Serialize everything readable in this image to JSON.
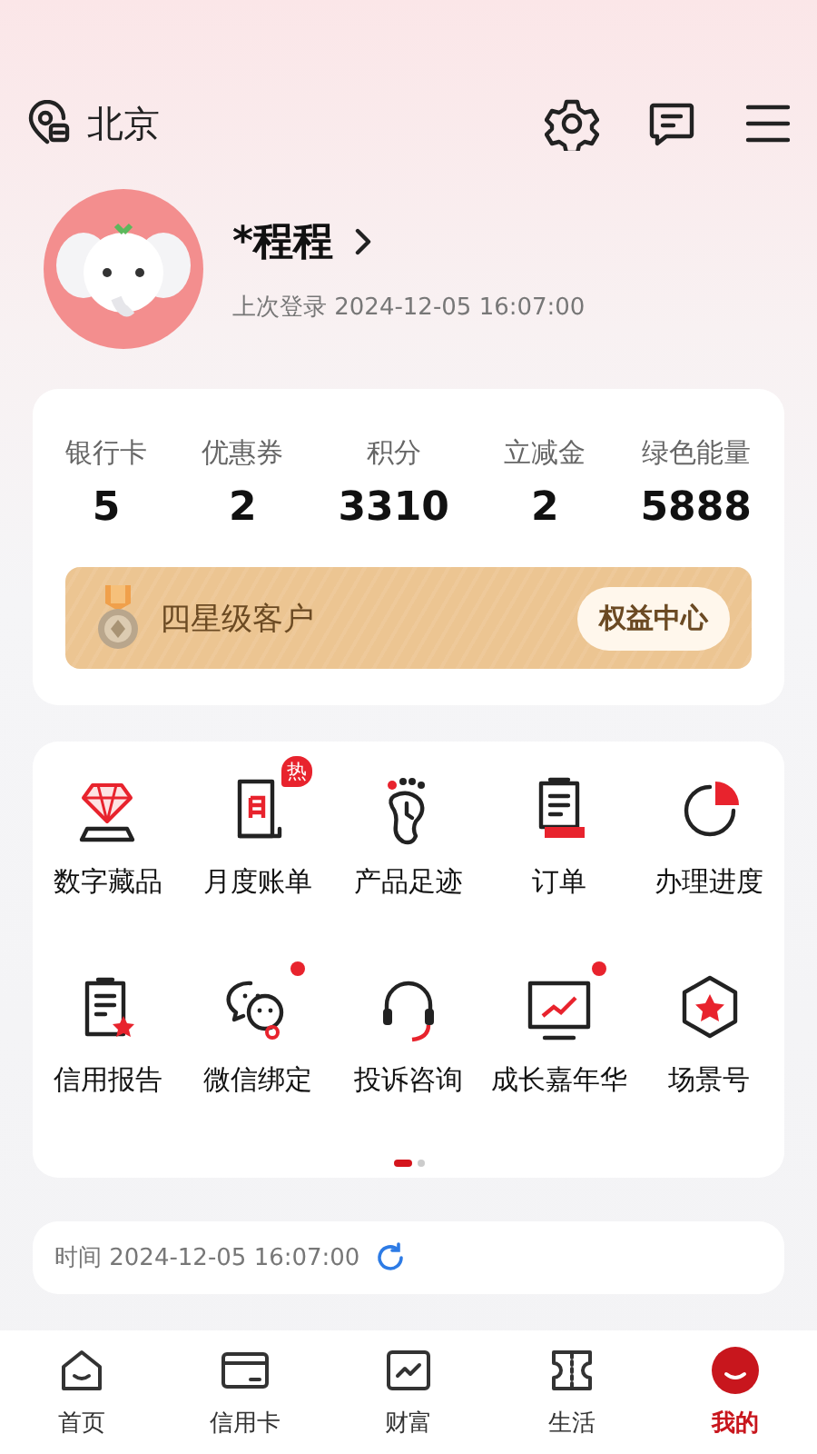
{
  "header": {
    "location": "北京"
  },
  "profile": {
    "name": "*程程",
    "last_login": "上次登录 2024-12-05 16:07:00"
  },
  "stats": [
    {
      "label": "银行卡",
      "value": "5"
    },
    {
      "label": "优惠券",
      "value": "2"
    },
    {
      "label": "积分",
      "value": "3310"
    },
    {
      "label": "立减金",
      "value": "2"
    },
    {
      "label": "绿色能量",
      "value": "5888"
    }
  ],
  "member": {
    "level": "四星级客户",
    "button": "权益中心"
  },
  "services": [
    {
      "label": "数字藏品",
      "kind": "gem",
      "dot": false
    },
    {
      "label": "月度账单",
      "kind": "bill",
      "badge": "热",
      "dot": false
    },
    {
      "label": "产品足迹",
      "kind": "foot",
      "dot": false
    },
    {
      "label": "订单",
      "kind": "order",
      "dot": false
    },
    {
      "label": "办理进度",
      "kind": "progress",
      "dot": false
    },
    {
      "label": "信用报告",
      "kind": "report",
      "dot": false
    },
    {
      "label": "微信绑定",
      "kind": "chat",
      "dot": true
    },
    {
      "label": "投诉咨询",
      "kind": "headset",
      "dot": false
    },
    {
      "label": "成长嘉年华",
      "kind": "monitor",
      "dot": true
    },
    {
      "label": "场景号",
      "kind": "hexstar",
      "dot": false
    }
  ],
  "pager": [
    {
      "selected": true
    },
    {
      "selected": false
    }
  ],
  "time_bar": {
    "text": "时间 2024-12-05 16:07:00"
  },
  "tabs": [
    {
      "label": "首页",
      "kind": "home",
      "selected": false
    },
    {
      "label": "信用卡",
      "kind": "card",
      "selected": false
    },
    {
      "label": "财富",
      "kind": "wealth",
      "selected": false
    },
    {
      "label": "生活",
      "kind": "ticket",
      "selected": false
    },
    {
      "label": "我的",
      "kind": "me",
      "selected": true
    }
  ]
}
